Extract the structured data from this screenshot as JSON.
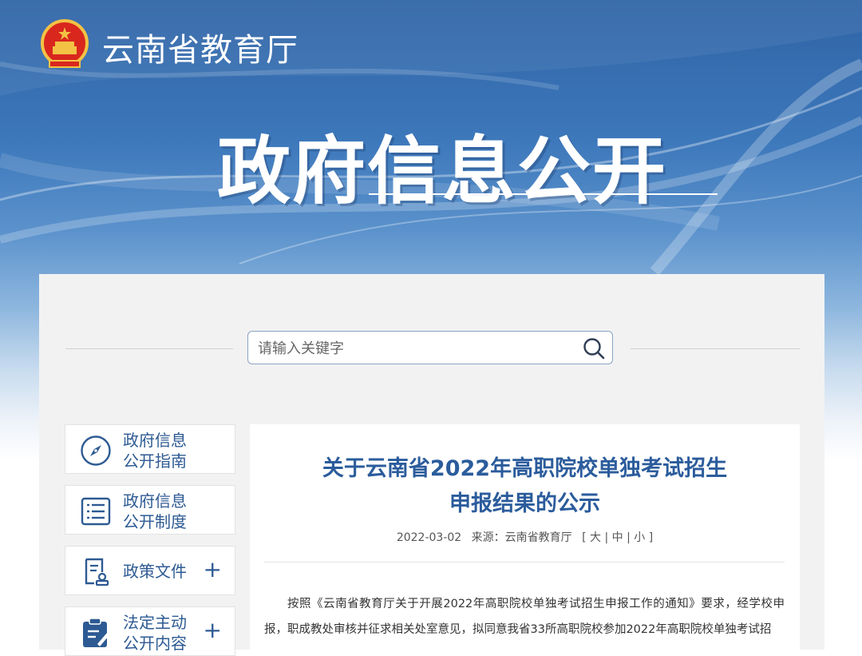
{
  "header": {
    "site_title": "云南省教育厅",
    "hero_title": "政府信息公开"
  },
  "search": {
    "placeholder": "请输入关键字"
  },
  "sidebar": {
    "items": [
      {
        "line1": "政府信息",
        "line2": "公开指南",
        "icon": "compass-icon"
      },
      {
        "line1": "政府信息",
        "line2": "公开制度",
        "icon": "list-document-icon"
      },
      {
        "line1": "政策文件",
        "line2": "",
        "icon": "document-stamp-icon",
        "expand": "+"
      },
      {
        "line1": "法定主动",
        "line2": "公开内容",
        "icon": "clipboard-edit-icon",
        "expand": "+"
      }
    ]
  },
  "article": {
    "title_line1": "关于云南省2022年高职院校单独考试招生",
    "title_line2": "申报结果的公示",
    "date": "2022-03-02",
    "source_label": "来源：云南省教育厅",
    "font_size_controls": "[ 大 | 中 | 小 ]",
    "body": "按照《云南省教育厅关于开展2022年高职院校单独考试招生申报工作的通知》要求，经学校申报，职成教处审核并征求相关处室意见，拟同意我省33所高职院校参加2022年高职院校单独考试招"
  },
  "colors": {
    "banner_blue": "#3d78bb",
    "title_blue": "#2b5c9c",
    "side_text_blue": "#2d5a93",
    "panel_gray": "#f2f2f2"
  }
}
